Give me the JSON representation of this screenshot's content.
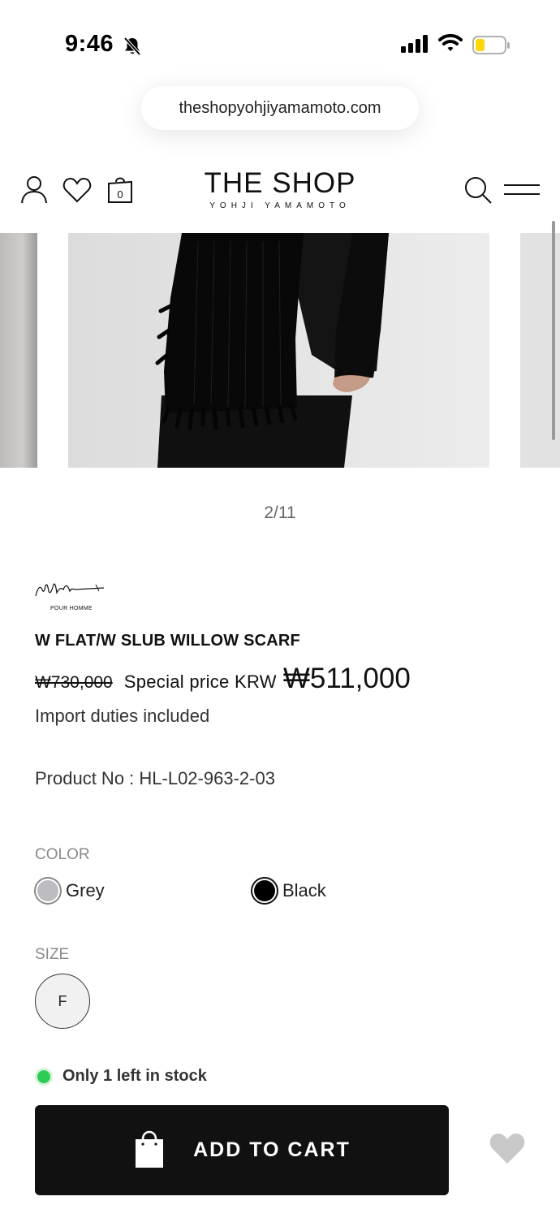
{
  "status_bar": {
    "time": "9:46"
  },
  "browser": {
    "url": "theshopyohjiyamamoto.com"
  },
  "header": {
    "logo_main": "THE SHOP",
    "logo_sub": "YOHJI YAMAMOTO",
    "cart_count": "0"
  },
  "gallery": {
    "counter": "2/11"
  },
  "product": {
    "brand_line": "POUR HOMME",
    "title": "W FLAT/W SLUB WILLOW SCARF",
    "original_price": "₩730,000",
    "special_label": "Special price KRW",
    "special_price": "₩511,000",
    "duties_note": "Import duties included",
    "product_no": "Product No : HL-L02-963-2-03"
  },
  "options": {
    "color_label": "COLOR",
    "colors": [
      {
        "name": "Grey",
        "hex": "#bdbdc1"
      },
      {
        "name": "Black",
        "hex": "#000000"
      }
    ],
    "size_label": "SIZE",
    "sizes": [
      "F"
    ]
  },
  "stock": {
    "text": "Only 1 left in stock",
    "color": "#2ecc55"
  },
  "actions": {
    "add_to_cart": "ADD TO CART"
  },
  "icons": [
    "bell-slash-icon",
    "signal-icon",
    "wifi-icon",
    "battery-icon",
    "user-icon",
    "heart-icon",
    "shopping-bag-icon",
    "search-icon",
    "menu-icon",
    "wishlist-heart-icon"
  ]
}
